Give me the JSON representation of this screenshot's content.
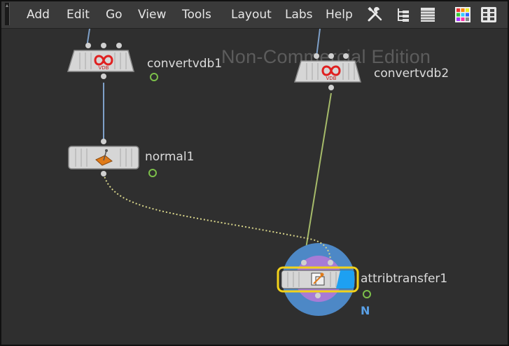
{
  "menu": {
    "items": [
      "Add",
      "Edit",
      "Go",
      "View",
      "Tools",
      "Layout",
      "Labs",
      "Help"
    ]
  },
  "toolbar_icons": [
    "wrench-screwdriver-icon",
    "tree-view-icon",
    "list-view-icon",
    "color-palette-icon",
    "settings-grid-icon"
  ],
  "watermark": "Non-Commercial Edition",
  "nodes": {
    "convertvdb1": {
      "label": "convertvdb1",
      "icon": "vdb-icon"
    },
    "convertvdb2": {
      "label": "convertvdb2",
      "icon": "vdb-icon"
    },
    "normal1": {
      "label": "normal1",
      "icon": "normal-icon"
    },
    "attribtransfer1": {
      "label": "attribtransfer1",
      "icon": "attribtransfer-icon",
      "flag_text": "N"
    }
  },
  "colors": {
    "background": "#2f2f2f",
    "menubar": "#3a3a3a",
    "wire_blue": "#7ea0c8",
    "wire_green": "#a6bb6a",
    "wire_dotted": "#d8d58a",
    "selection_yellow": "#f2d21a",
    "display_flag_blue": "#1da0f2"
  }
}
